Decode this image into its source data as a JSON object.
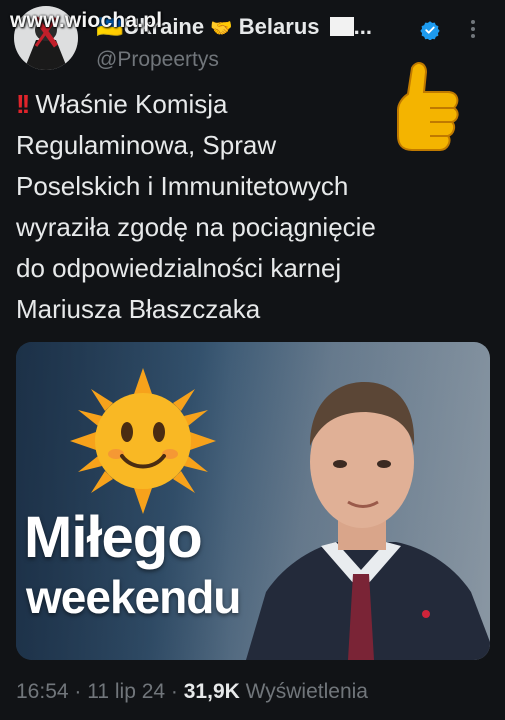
{
  "header": {
    "watermark": "www.wiocha.pl",
    "display_name_prefix": "🇺🇦Ukraine",
    "handshake": "🤝",
    "display_name_suffix": "Belarus",
    "display_name_ellipsis": "...",
    "handle": "@Propeertys"
  },
  "tweet": {
    "bang": "!!",
    "lines": [
      "Właśnie Komisja",
      "Regulaminowa, Spraw",
      "Poselskich i Immunitetowych",
      "wyraziła zgodę na pociągnięcie",
      "do odpowiedzialności karnej",
      "Mariusza Błaszczaka"
    ]
  },
  "media": {
    "caption_line1": "Miłego",
    "caption_line2": "weekendu"
  },
  "meta": {
    "time": "16:54",
    "sep1": " · ",
    "date": "11 lip 24",
    "sep2": " · ",
    "views_count": "31,9K",
    "views_label": " Wyświetlenia"
  },
  "colors": {
    "background": "#111316",
    "text": "#e7e9ea",
    "muted": "#71767b",
    "verified": "#1d9bf0",
    "bang": "#e0242b"
  },
  "icons": [
    "avatar",
    "verified-badge-icon",
    "more-options-icon",
    "thumbs-up-icon",
    "sun-emoji-icon"
  ]
}
